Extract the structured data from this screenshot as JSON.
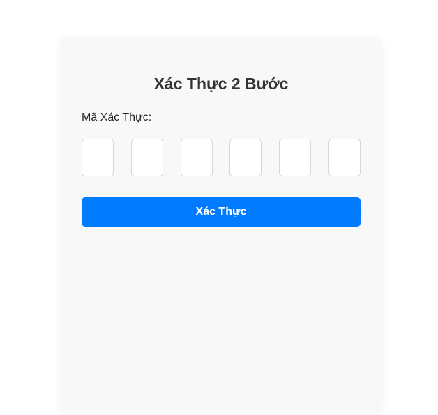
{
  "form": {
    "title": "Xác Thực 2 Bước",
    "code_label": "Mã Xác Thực:",
    "digits": [
      "",
      "",
      "",
      "",
      "",
      ""
    ],
    "submit_label": "Xác Thực"
  },
  "colors": {
    "accent": "#007bff",
    "card_background": "#f8f8f8",
    "title_text": "#333333"
  }
}
